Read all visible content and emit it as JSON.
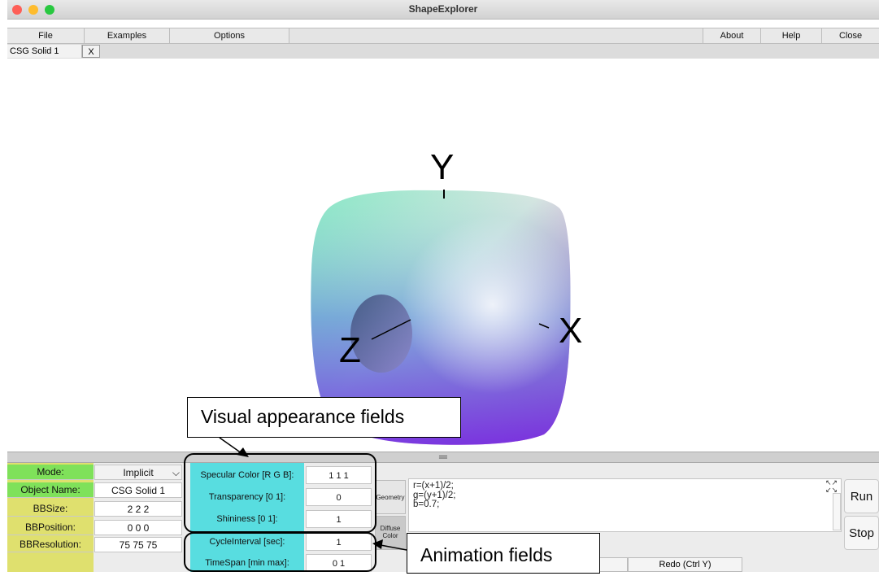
{
  "window": {
    "title": "ShapeExplorer"
  },
  "menubar": {
    "file": "File",
    "examples": "Examples",
    "options": "Options",
    "about": "About",
    "help": "Help",
    "close": "Close"
  },
  "tabs": [
    {
      "label": "CSG Solid 1",
      "close": "X"
    }
  ],
  "viewport": {
    "axis_x": "X",
    "axis_y": "Y",
    "axis_z": "Z"
  },
  "properties": {
    "mode": {
      "label": "Mode:",
      "value": "Implicit"
    },
    "object_name": {
      "label": "Object Name:",
      "value": "CSG Solid 1"
    },
    "bbsize": {
      "label": "BBSize:",
      "value": "2 2 2"
    },
    "bbposition": {
      "label": "BBPosition:",
      "value": "0 0 0"
    },
    "bbresolution": {
      "label": "BBResolution:",
      "value": "75 75 75"
    }
  },
  "appearance": {
    "specular": {
      "label": "Specular Color [R G B]:",
      "value": "1 1 1"
    },
    "transparency": {
      "label": "Transparency [0 1]:",
      "value": "0"
    },
    "shininess": {
      "label": "Shininess [0 1]:",
      "value": "1"
    }
  },
  "animation": {
    "cycle": {
      "label": "CycleInterval [sec]:",
      "value": "1"
    },
    "timespan": {
      "label": "TimeSpan [min max]:",
      "value": "0 1"
    }
  },
  "side_tabs": {
    "geometry": "Geometry",
    "diffuse": "Diffuse Color"
  },
  "editor": {
    "code": "r=(x+1)/2;\ng=(y+1)/2;\nb=0.7;"
  },
  "buttons": {
    "run": "Run",
    "stop": "Stop",
    "redo": "Redo (Ctrl Y)"
  },
  "callouts": {
    "visual": "Visual appearance fields",
    "animation": "Animation fields"
  },
  "colors": {
    "cyan_panel": "#58dde0",
    "green_label": "#7fe15a",
    "yellow_label": "#dfe06e"
  }
}
